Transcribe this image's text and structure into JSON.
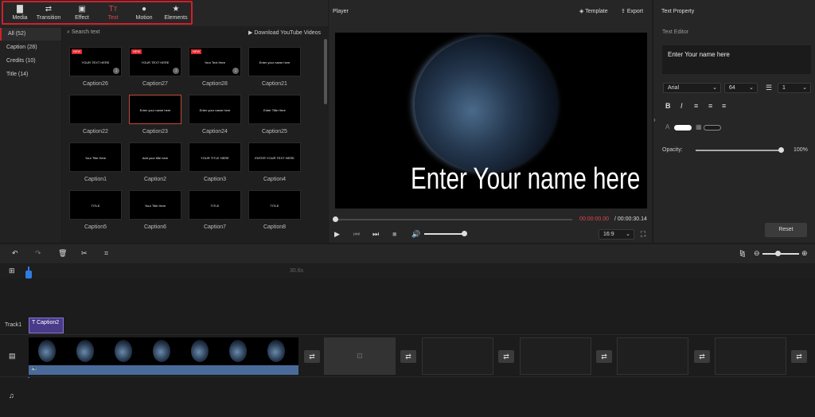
{
  "toolbar": {
    "tabs": [
      {
        "label": "Media",
        "icon": "folder-icon"
      },
      {
        "label": "Transition",
        "icon": "swap-icon"
      },
      {
        "label": "Effect",
        "icon": "effect-icon"
      },
      {
        "label": "Text",
        "icon": "text-icon"
      },
      {
        "label": "Motion",
        "icon": "motion-icon"
      },
      {
        "label": "Elements",
        "icon": "elements-icon"
      }
    ],
    "active_tab": "Text",
    "accent": "#d0202a"
  },
  "categories": [
    "All (52)",
    "Caption (28)",
    "Credits (10)",
    "Title (14)"
  ],
  "search": {
    "placeholder": "Search text",
    "download_label": "Download YouTube Videos"
  },
  "grid": [
    {
      "label": "Caption26",
      "new": true,
      "download": true,
      "preview": "YOUR TEXT HERE"
    },
    {
      "label": "Caption27",
      "new": true,
      "download": true,
      "preview": "YOUR TEXT HERE"
    },
    {
      "label": "Caption28",
      "new": true,
      "download": true,
      "preview": "Your Text Here"
    },
    {
      "label": "Caption21",
      "preview": "Enter your name here"
    },
    {
      "label": "Caption22",
      "preview": ""
    },
    {
      "label": "Caption23",
      "preview": "Enter your name here",
      "selected": true
    },
    {
      "label": "Caption24",
      "preview": "Enter your name here"
    },
    {
      "label": "Caption25",
      "preview": "Enter Title Here"
    },
    {
      "label": "Caption1",
      "preview": "Your Title Here"
    },
    {
      "label": "Caption2",
      "preview": "Add your title here"
    },
    {
      "label": "Caption3",
      "preview": "YOUR TITLE HERE"
    },
    {
      "label": "Caption4",
      "preview": "ENTER YOUR TEXT HERE"
    },
    {
      "label": "Caption5",
      "preview": "TITLE"
    },
    {
      "label": "Caption6",
      "preview": "Your Title Here"
    },
    {
      "label": "Caption7",
      "preview": "TITLE"
    },
    {
      "label": "Caption8",
      "preview": "TITLE"
    }
  ],
  "player": {
    "title": "Player",
    "template_label": "Template",
    "export_label": "Export",
    "overlay_text": "Enter Your name here",
    "time_current": "00:00:00.00",
    "time_total": "/ 00:00:30.14",
    "aspect": "16:9"
  },
  "properties": {
    "title": "Text Property",
    "editor_label": "Text Editor",
    "editor_text": "Enter Your name here",
    "font": "Arial",
    "size": "64",
    "line_spacing": "1",
    "opacity_label": "Opacity:",
    "opacity_value": "100%",
    "opacity": 1.0,
    "reset_label": "Reset"
  },
  "timeline": {
    "ruler_mark": "30.6s",
    "track1_label": "Track1",
    "clip_label": "Caption2"
  }
}
